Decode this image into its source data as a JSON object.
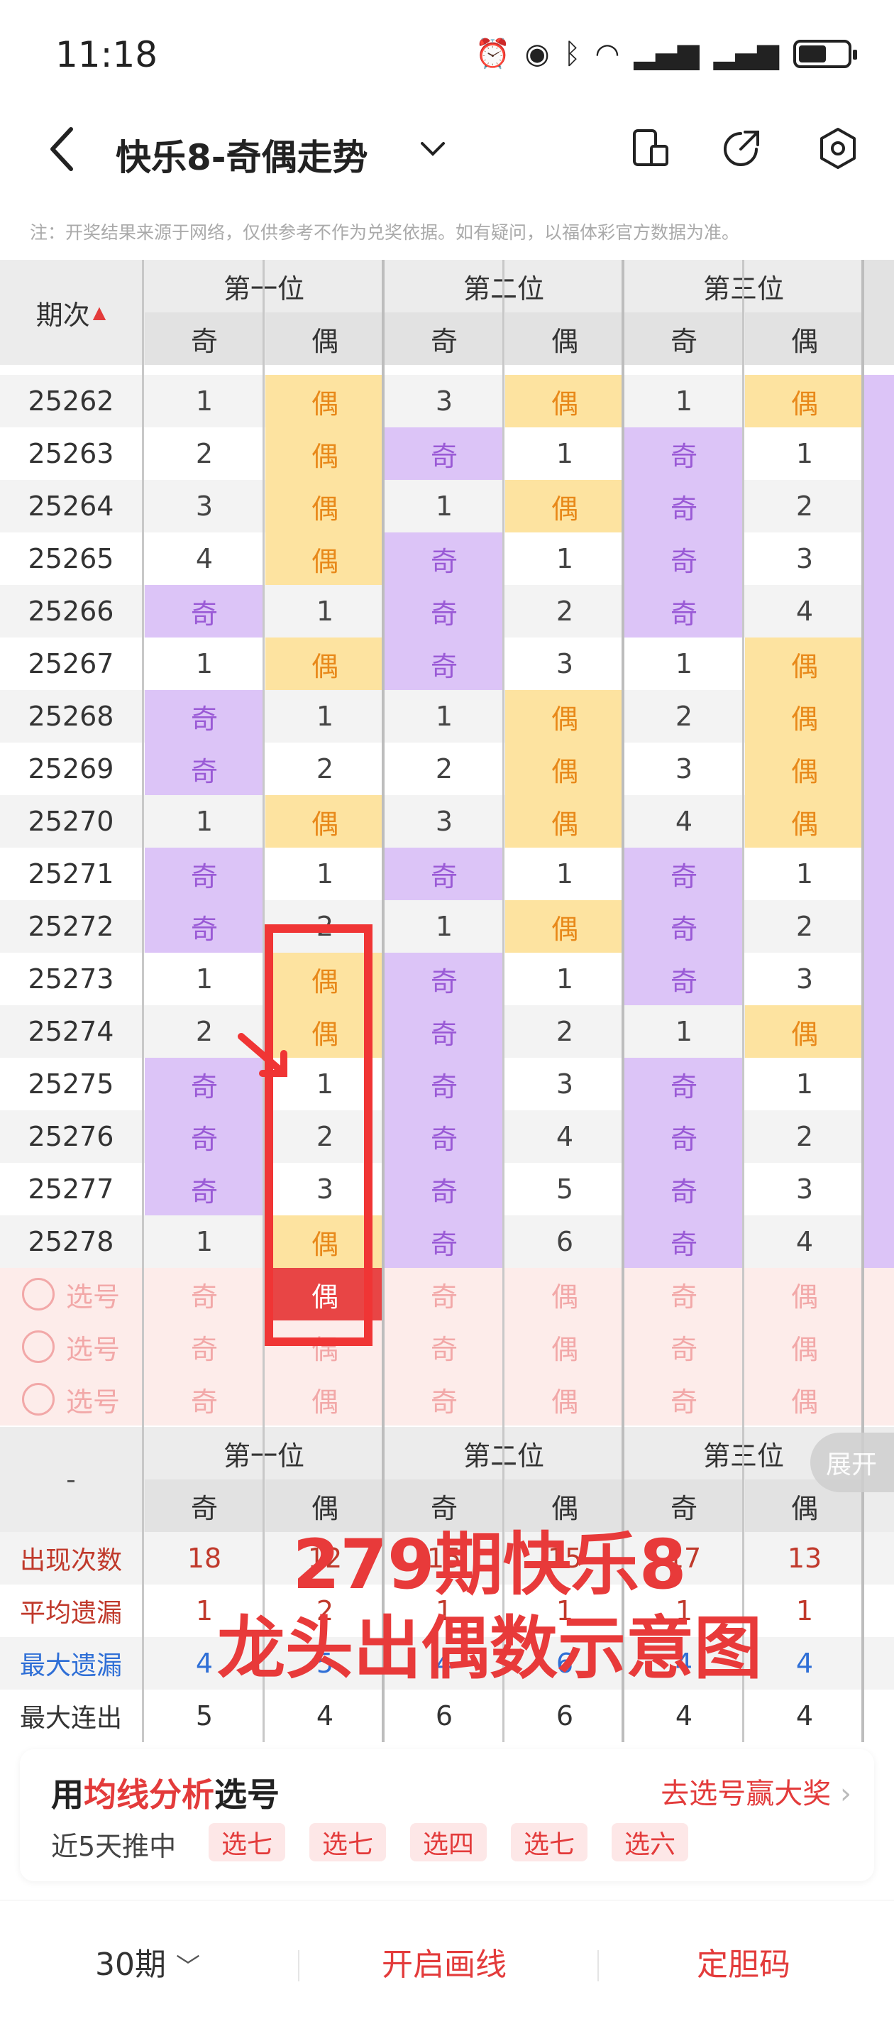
{
  "status": {
    "time": "11:18"
  },
  "header": {
    "title": "快乐8-奇偶走势"
  },
  "notice": "注：开奖结果来源于网络，仅供参考不作为兑奖依据。如有疑问，以福体彩官方数据为准。",
  "table": {
    "period_header": "期次",
    "group_headers": [
      "第一位",
      "第二位",
      "第三位"
    ],
    "odd_label": "奇",
    "even_label": "偶",
    "rows": [
      {
        "p": "25262",
        "v": [
          "1",
          "偶",
          "3",
          "偶",
          "1",
          "偶"
        ]
      },
      {
        "p": "25263",
        "v": [
          "2",
          "偶",
          "奇",
          "1",
          "奇",
          "1"
        ]
      },
      {
        "p": "25264",
        "v": [
          "3",
          "偶",
          "1",
          "偶",
          "奇",
          "2"
        ]
      },
      {
        "p": "25265",
        "v": [
          "4",
          "偶",
          "奇",
          "1",
          "奇",
          "3"
        ]
      },
      {
        "p": "25266",
        "v": [
          "奇",
          "1",
          "奇",
          "2",
          "奇",
          "4"
        ]
      },
      {
        "p": "25267",
        "v": [
          "1",
          "偶",
          "奇",
          "3",
          "1",
          "偶"
        ]
      },
      {
        "p": "25268",
        "v": [
          "奇",
          "1",
          "1",
          "偶",
          "2",
          "偶"
        ]
      },
      {
        "p": "25269",
        "v": [
          "奇",
          "2",
          "2",
          "偶",
          "3",
          "偶"
        ]
      },
      {
        "p": "25270",
        "v": [
          "1",
          "偶",
          "3",
          "偶",
          "4",
          "偶"
        ]
      },
      {
        "p": "25271",
        "v": [
          "奇",
          "1",
          "奇",
          "1",
          "奇",
          "1"
        ]
      },
      {
        "p": "25272",
        "v": [
          "奇",
          "2",
          "1",
          "偶",
          "奇",
          "2"
        ]
      },
      {
        "p": "25273",
        "v": [
          "1",
          "偶",
          "奇",
          "1",
          "奇",
          "3"
        ]
      },
      {
        "p": "25274",
        "v": [
          "2",
          "偶",
          "奇",
          "2",
          "1",
          "偶"
        ]
      },
      {
        "p": "25275",
        "v": [
          "奇",
          "1",
          "奇",
          "3",
          "奇",
          "1"
        ]
      },
      {
        "p": "25276",
        "v": [
          "奇",
          "2",
          "奇",
          "4",
          "奇",
          "2"
        ]
      },
      {
        "p": "25277",
        "v": [
          "奇",
          "3",
          "奇",
          "5",
          "奇",
          "3"
        ]
      },
      {
        "p": "25278",
        "v": [
          "1",
          "偶",
          "奇",
          "6",
          "奇",
          "4"
        ]
      }
    ],
    "pick_label": "选号",
    "pick_rows": 3
  },
  "stats": {
    "placeholder": "-",
    "rows": [
      {
        "label": "出现次数",
        "color": "#c0392b",
        "v": [
          "18",
          "12",
          "15",
          "15",
          "17",
          "13"
        ]
      },
      {
        "label": "平均遗漏",
        "color": "#c0392b",
        "v": [
          "1",
          "2",
          "1",
          "1",
          "1",
          "1"
        ]
      },
      {
        "label": "最大遗漏",
        "color": "#2f6fd6",
        "v": [
          "4",
          "5",
          "4",
          "6",
          "4",
          "4"
        ]
      },
      {
        "label": "最大连出",
        "color": "#333333",
        "v": [
          "5",
          "4",
          "6",
          "6",
          "4",
          "4"
        ]
      }
    ]
  },
  "expand_label": "展开",
  "overlay": {
    "line1": "279期快乐8",
    "line2": "龙头出偶数示意图"
  },
  "promo": {
    "title_prefix": "用",
    "title_highlight": "均线分析",
    "title_suffix": "选号",
    "link": "去选号赢大奖",
    "subtitle": "近5天推中",
    "tags": [
      "选七",
      "选七",
      "选四",
      "选七",
      "选六"
    ]
  },
  "bottom_bar": {
    "periods": "30期",
    "draw_line": "开启画线",
    "dan_code": "定胆码"
  },
  "colors": {
    "odd_bg": "#dcc4f7",
    "even_bg": "#fde3a0",
    "accent": "#e33b3b"
  }
}
